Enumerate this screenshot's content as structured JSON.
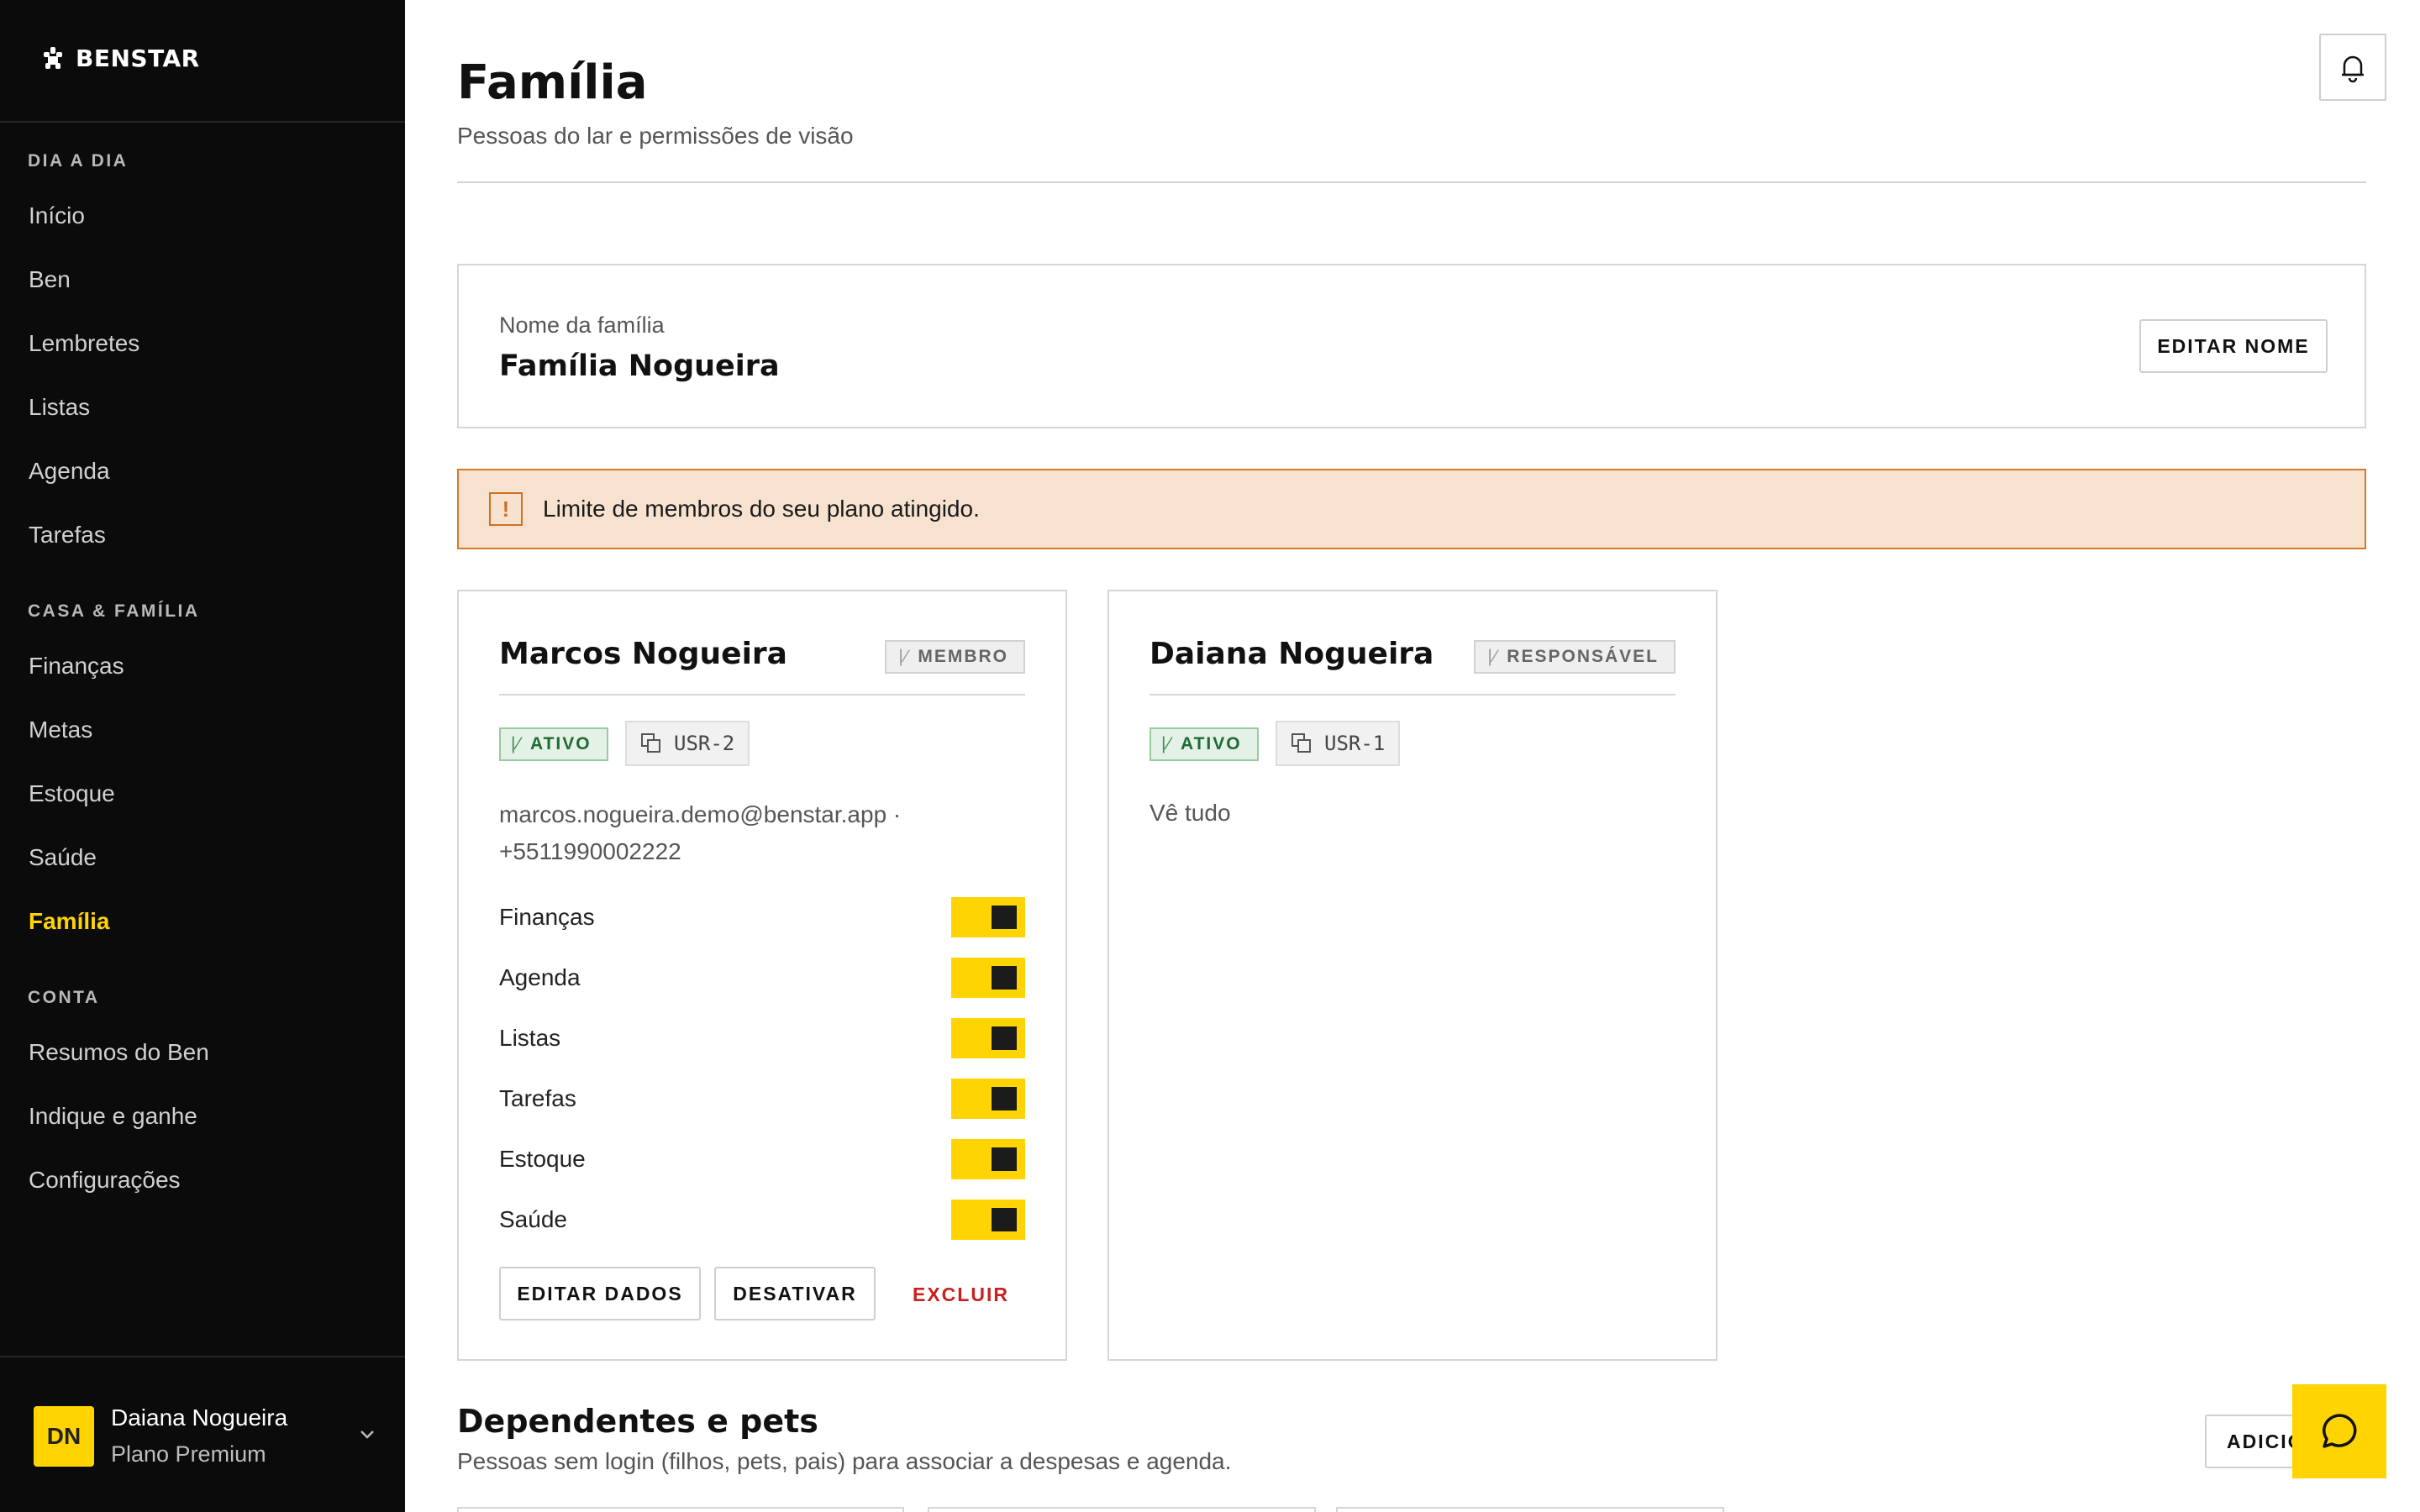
{
  "brand": {
    "name": "BENSTAR"
  },
  "sidebar": {
    "sections": [
      {
        "label": "DIA A DIA",
        "items": [
          "Início",
          "Ben",
          "Lembretes",
          "Listas",
          "Agenda",
          "Tarefas"
        ]
      },
      {
        "label": "CASA & FAMÍLIA",
        "items": [
          "Finanças",
          "Metas",
          "Estoque",
          "Saúde",
          "Família"
        ]
      },
      {
        "label": "CONTA",
        "items": [
          "Resumos do Ben",
          "Indique e ganhe",
          "Configurações"
        ]
      }
    ],
    "active_item": "Família",
    "user": {
      "initials": "DN",
      "name": "Daiana Nogueira",
      "plan": "Plano Premium"
    }
  },
  "header": {
    "title": "Família",
    "subtitle": "Pessoas do lar e permissões de visão",
    "bell_icon": "bell-icon"
  },
  "family": {
    "label": "Nome da família",
    "name": "Família Nogueira",
    "edit_button": "EDITAR NOME"
  },
  "alert": {
    "icon": "!",
    "text": "Limite de membros do seu plano atingido.",
    "color": "#d47a2c"
  },
  "members": [
    {
      "name": "Marcos Nogueira",
      "role": "MEMBRO",
      "status": "ATIVO",
      "id": "USR-2",
      "contact_line1": "marcos.nogueira.demo@benstar.app ·",
      "contact_line2": "+5511990002222",
      "permissions": [
        {
          "label": "Finanças",
          "enabled": true
        },
        {
          "label": "Agenda",
          "enabled": true
        },
        {
          "label": "Listas",
          "enabled": true
        },
        {
          "label": "Tarefas",
          "enabled": true
        },
        {
          "label": "Estoque",
          "enabled": true
        },
        {
          "label": "Saúde",
          "enabled": true
        }
      ],
      "actions": {
        "edit": "EDITAR DADOS",
        "deactivate": "DESATIVAR",
        "delete": "EXCLUIR"
      }
    },
    {
      "name": "Daiana Nogueira",
      "role": "RESPONSÁVEL",
      "status": "ATIVO",
      "id": "USR-1",
      "description": "Vê tudo"
    }
  ],
  "dependents": {
    "title": "Dependentes e pets",
    "subtitle": "Pessoas sem login (filhos, pets, pais) para associar a despesas e agenda.",
    "add_button": "ADICIONAR"
  },
  "colors": {
    "accent": "#ffd400",
    "sidebar_bg": "#0b0b0b",
    "danger": "#c8201e",
    "success": "#1f6b34"
  }
}
